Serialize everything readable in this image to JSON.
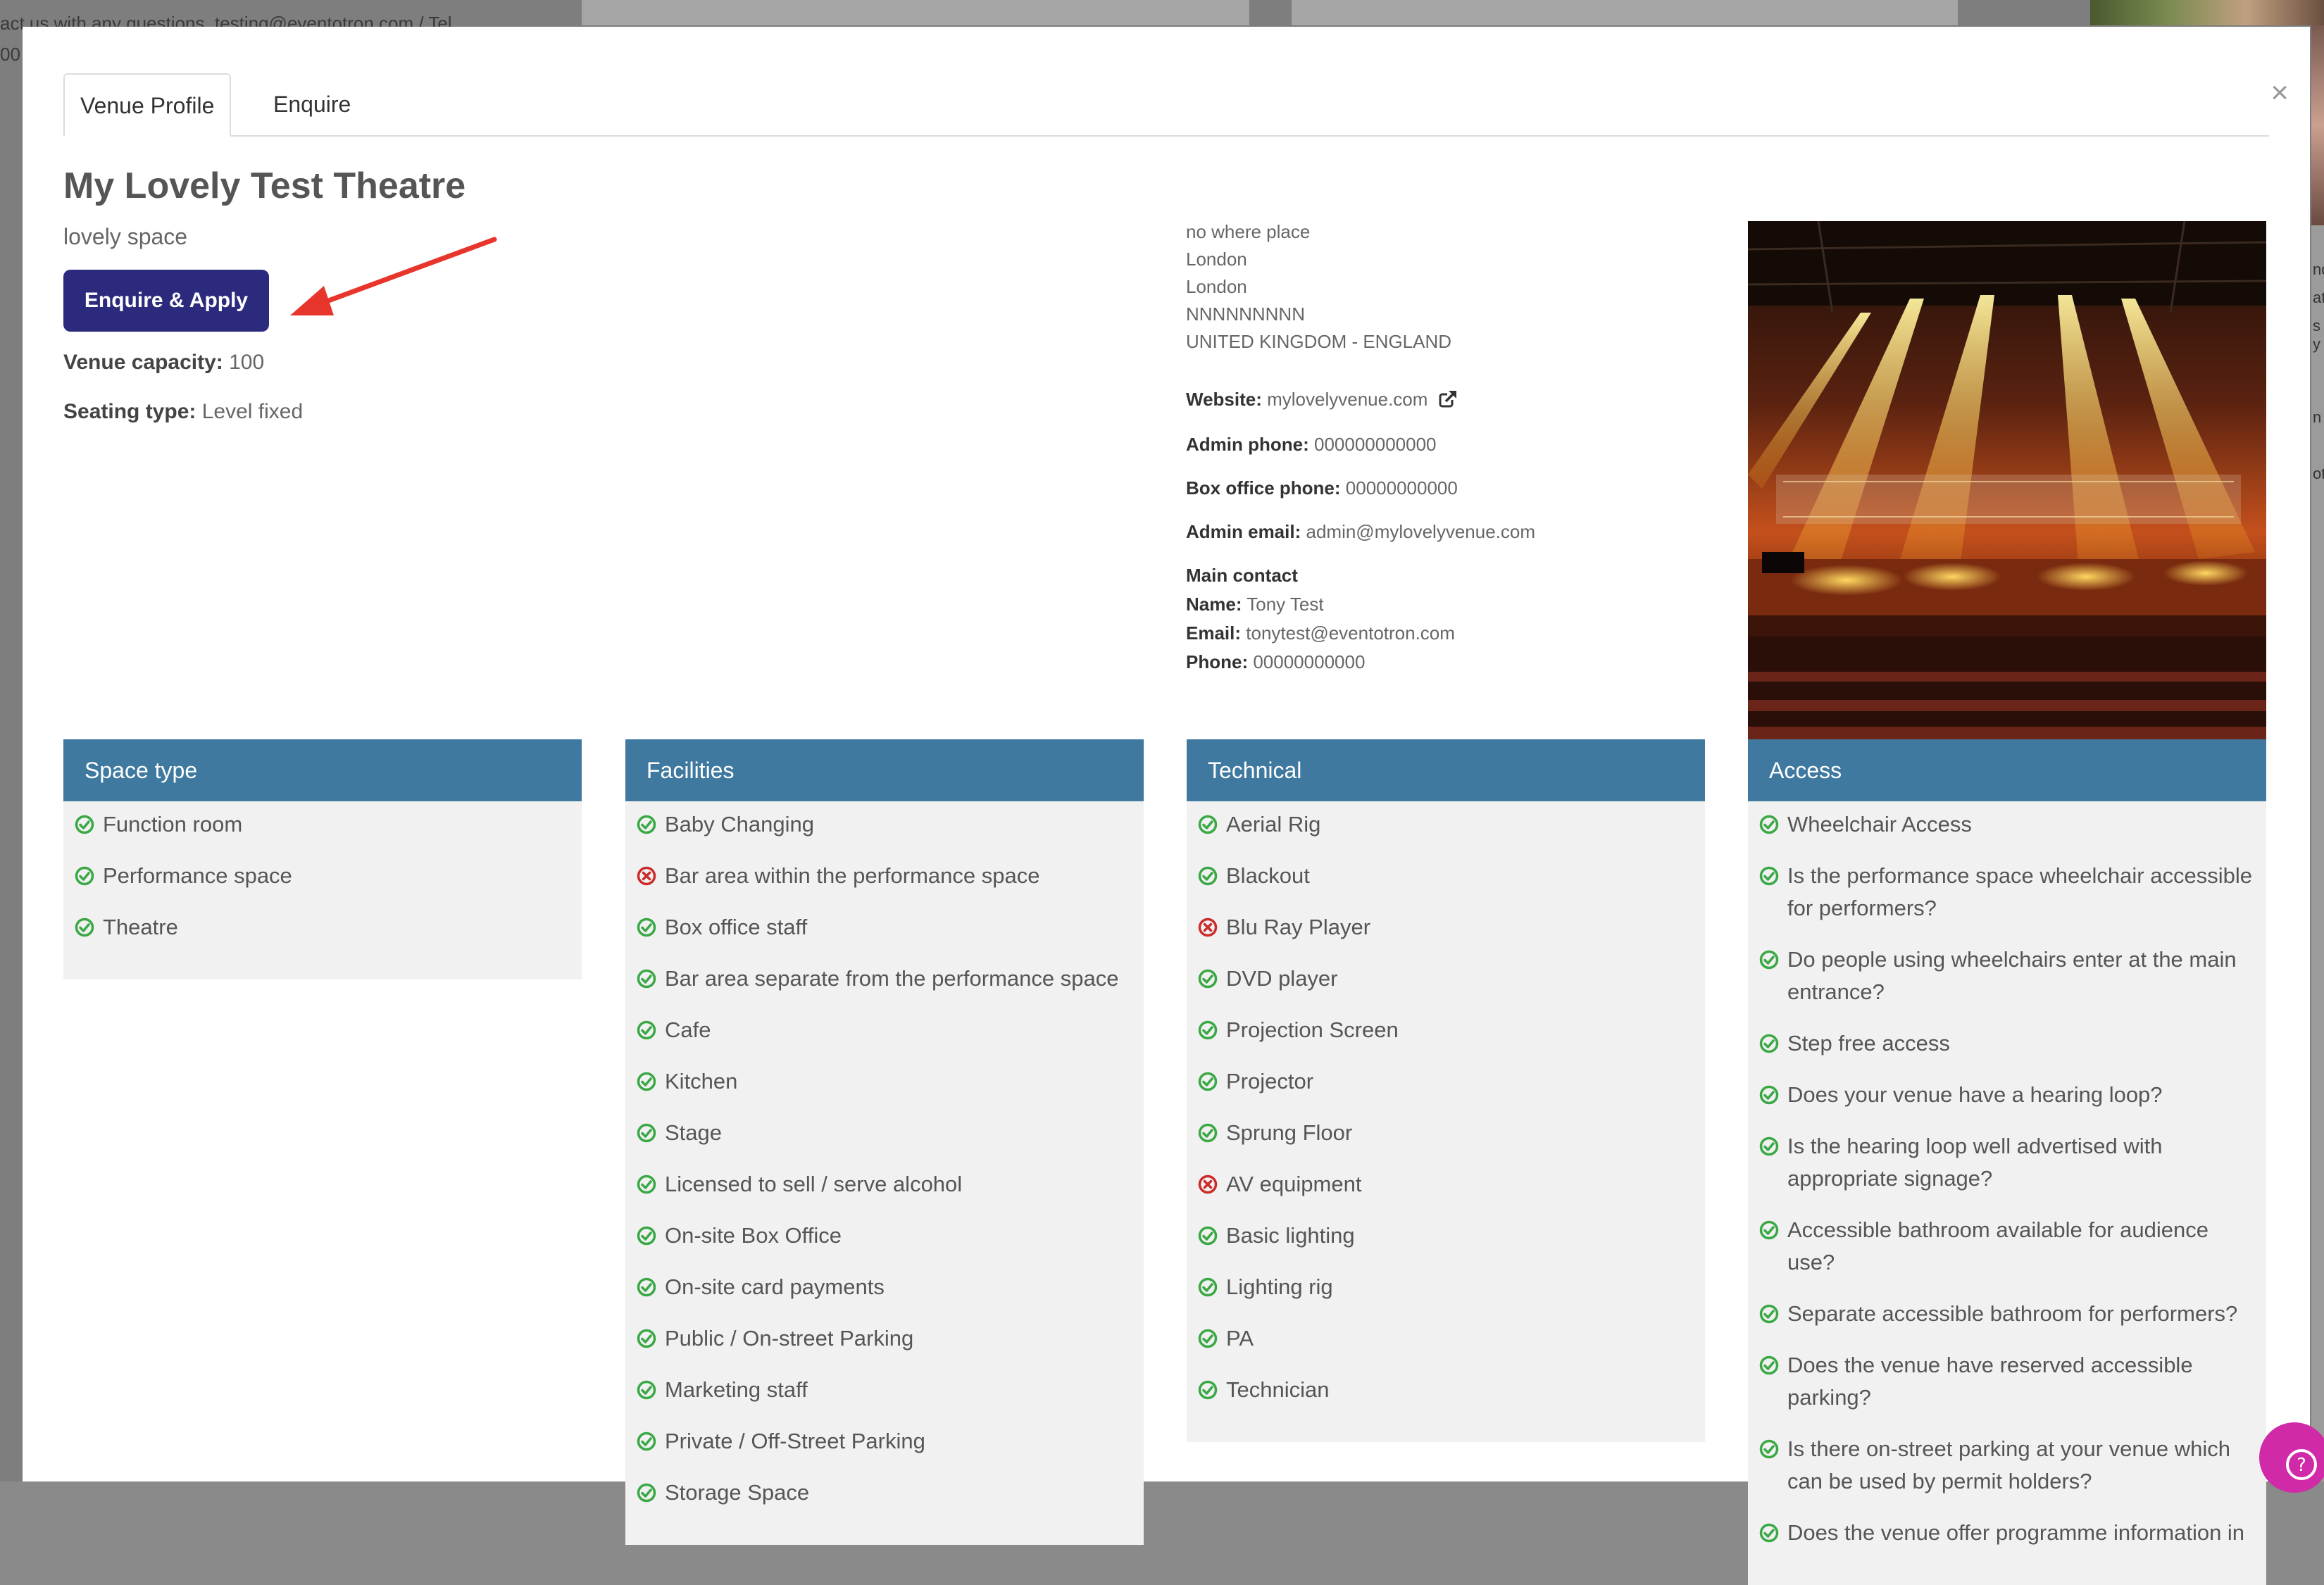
{
  "background": {
    "text_line": "act us with any questions, testing@eventotron.com / Tel",
    "text_line2": "00",
    "side_text": [
      "nd",
      "ate",
      "s y",
      "n",
      "ot"
    ]
  },
  "modal": {
    "tabs": [
      {
        "label": "Venue Profile",
        "active": true
      },
      {
        "label": "Enquire",
        "active": false
      }
    ],
    "close_icon": "close-icon"
  },
  "venue": {
    "title": "My Lovely Test Theatre",
    "subtitle": "lovely space",
    "cta_label": "Enquire & Apply",
    "capacity_label": "Venue capacity:",
    "capacity_value": "100",
    "seating_label": "Seating type:",
    "seating_value": "Level fixed",
    "address": [
      "no where place",
      "London",
      "London",
      "NNNNNNNNN",
      "UNITED KINGDOM - ENGLAND"
    ],
    "website_label": "Website:",
    "website_value": "mylovelyvenue.com",
    "admin_phone_label": "Admin phone:",
    "admin_phone_value": "000000000000",
    "box_office_label": "Box office phone:",
    "box_office_value": "00000000000",
    "admin_email_label": "Admin email:",
    "admin_email_value": "admin@mylovelyvenue.com",
    "main_contact_label": "Main contact",
    "name_label": "Name:",
    "name_value": "Tony Test",
    "email_label": "Email:",
    "email_value": "tonytest@eventotron.com",
    "phone_label": "Phone:",
    "phone_value": "00000000000"
  },
  "colors": {
    "panel_header": "#3f79a0",
    "cta": "#2c2a7d",
    "check": "#3aa845",
    "cross": "#cc2b2b",
    "arrow": "#e8352b"
  },
  "panels": [
    {
      "title": "Space type",
      "items": [
        {
          "label": "Function room",
          "ok": true
        },
        {
          "label": "Performance space",
          "ok": true
        },
        {
          "label": "Theatre",
          "ok": true
        }
      ]
    },
    {
      "title": "Facilities",
      "items": [
        {
          "label": "Baby Changing",
          "ok": true
        },
        {
          "label": "Bar area within the performance space",
          "ok": false
        },
        {
          "label": "Box office staff",
          "ok": true
        },
        {
          "label": "Bar area separate from the performance space",
          "ok": true
        },
        {
          "label": "Cafe",
          "ok": true
        },
        {
          "label": "Kitchen",
          "ok": true
        },
        {
          "label": "Stage",
          "ok": true
        },
        {
          "label": "Licensed to sell / serve alcohol",
          "ok": true
        },
        {
          "label": "On-site Box Office",
          "ok": true
        },
        {
          "label": "On-site card payments",
          "ok": true
        },
        {
          "label": "Public / On-street Parking",
          "ok": true
        },
        {
          "label": "Marketing staff",
          "ok": true
        },
        {
          "label": "Private / Off-Street Parking",
          "ok": true
        },
        {
          "label": "Storage Space",
          "ok": true
        }
      ]
    },
    {
      "title": "Technical",
      "items": [
        {
          "label": "Aerial Rig",
          "ok": true
        },
        {
          "label": "Blackout",
          "ok": true
        },
        {
          "label": "Blu Ray Player",
          "ok": false
        },
        {
          "label": "DVD player",
          "ok": true
        },
        {
          "label": "Projection Screen",
          "ok": true
        },
        {
          "label": "Projector",
          "ok": true
        },
        {
          "label": "Sprung Floor",
          "ok": true
        },
        {
          "label": "AV equipment",
          "ok": false
        },
        {
          "label": "Basic lighting",
          "ok": true
        },
        {
          "label": "Lighting rig",
          "ok": true
        },
        {
          "label": "PA",
          "ok": true
        },
        {
          "label": "Technician",
          "ok": true
        }
      ]
    },
    {
      "title": "Access",
      "items": [
        {
          "label": "Wheelchair Access",
          "ok": true
        },
        {
          "label": "Is the performance space wheelchair accessible for performers?",
          "ok": true
        },
        {
          "label": "Do people using wheelchairs enter at the main entrance?",
          "ok": true
        },
        {
          "label": "Step free access",
          "ok": true
        },
        {
          "label": "Does your venue have a hearing loop?",
          "ok": true
        },
        {
          "label": "Is the hearing loop well advertised with appropriate signage?",
          "ok": true
        },
        {
          "label": "Accessible bathroom available for audience use?",
          "ok": true
        },
        {
          "label": "Separate accessible bathroom for performers?",
          "ok": true
        },
        {
          "label": "Does the venue have reserved accessible parking?",
          "ok": true
        },
        {
          "label": "Is there on-street parking at your venue which can be used by permit holders?",
          "ok": true
        },
        {
          "label": "Does the venue offer programme information in",
          "ok": true
        }
      ]
    }
  ],
  "help_icon": "question-icon"
}
